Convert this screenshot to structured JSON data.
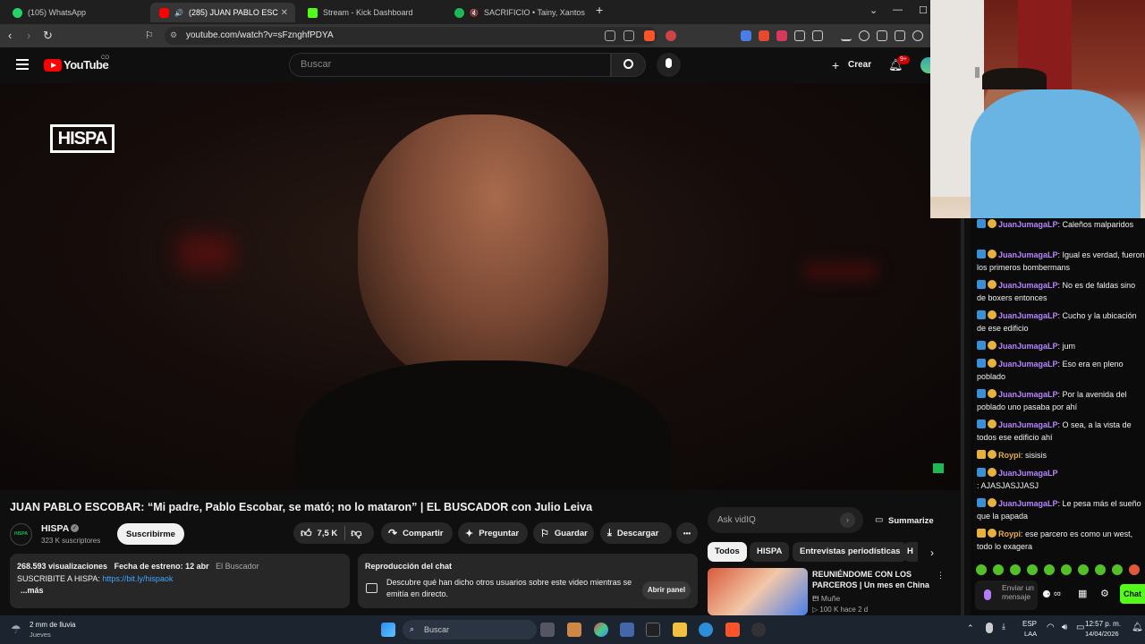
{
  "browser": {
    "tabs": [
      {
        "label": "(105) WhatsApp",
        "color": "#25d366"
      },
      {
        "label": "(285) JUAN PABLO ESCOBAR",
        "color": "#ff0000"
      },
      {
        "label": "Stream - Kick Dashboard",
        "color": "#53fc18"
      },
      {
        "label": "SACRIFICIO • Tainy, Xantos",
        "color": "#1db954"
      }
    ],
    "new_tab": "+",
    "url": "youtube.com/watch?v=sFznghfPDYA",
    "brave_badge": "1"
  },
  "youtube": {
    "logo": "YouTube",
    "logo_region": "CO",
    "search_placeholder": "Buscar",
    "create_label": "Crear",
    "notif_count": "9+"
  },
  "video": {
    "watermark": "HISPA",
    "title": "JUAN PABLO ESCOBAR: “Mi padre, Pablo Escobar, se mató; no lo mataron” | EL BUSCADOR con Julio Leiva",
    "channel": "HISPA",
    "subscribers": "323 K suscriptores",
    "subscribe_label": "Suscribirme",
    "likes": "7,5 K",
    "share_label": "Compartir",
    "ask_label": "Preguntar",
    "save_label": "Guardar",
    "download_label": "Descargar",
    "more": "•••"
  },
  "description": {
    "views": "268.593 visualizaciones",
    "date": "Fecha de estreno: 12 abr",
    "tag": "El Buscador",
    "line2": "SUSCRIBITE A HISPA:",
    "link": "https://bit.ly/hispaok",
    "more": "...más"
  },
  "chat_replay": {
    "title": "Reproducción del chat",
    "text": "Descubre qué han dicho otros usuarios sobre este video mientras se emitía en directo.",
    "button": "Abrir panel"
  },
  "sidebar": {
    "ask_placeholder": "Ask vidIQ",
    "summarize": "Summarize",
    "chips": [
      "Todos",
      "HISPA",
      "Entrevistas periodísticas",
      "H"
    ],
    "rec_title": "REUNIÉNDOME CON LOS PARCEROS | Un mes en China ...",
    "rec_channel": "El Muñe",
    "rec_meta": "▷ 100 K  hace 2 d"
  },
  "chat": {
    "messages": [
      {
        "user": "JuanJumagaLP",
        "text": ": Caleños malparidos",
        "gold": false
      },
      {
        "user": "JuanJumagaLP",
        "text": ": Igual es verdad, fueron los primeros bombermans",
        "gold": false
      },
      {
        "user": "JuanJumagaLP",
        "text": ": No es de faldas sino de boxers entonces",
        "gold": false
      },
      {
        "user": "JuanJumagaLP",
        "text": ": Cucho y la ubicación de ese edificio",
        "gold": false
      },
      {
        "user": "JuanJumagaLP",
        "text": ": jum",
        "gold": false
      },
      {
        "user": "JuanJumagaLP",
        "text": ": Eso era en pleno poblado",
        "gold": false
      },
      {
        "user": "JuanJumagaLP",
        "text": ": Por la avenida del poblado uno pasaba por ahí",
        "gold": false
      },
      {
        "user": "JuanJumagaLP",
        "text": ": O sea, a la vista de todos ese edificio ahí",
        "gold": false
      },
      {
        "user": "Roypi",
        "text": ": sisisis",
        "gold": true
      },
      {
        "user": "JuanJumagaLP",
        "text": ": AJASJASJJASJ",
        "gold": false
      },
      {
        "user": "JuanJumagaLP",
        "text": ": Le pesa más el sueño que la papada",
        "gold": false
      },
      {
        "user": "Roypi",
        "text": ": ese parcero es como un west, todo lo exagera",
        "gold": true
      }
    ],
    "send_placeholder": "Enviar un mensaje",
    "chat_button": "Chat"
  },
  "taskbar": {
    "weather": "2 mm de lluvia",
    "day": "Jueves",
    "search": "Buscar",
    "lang1": "ESP",
    "lang2": "LAA",
    "time": "12:57 p. m.",
    "date": "14/04/2026"
  }
}
